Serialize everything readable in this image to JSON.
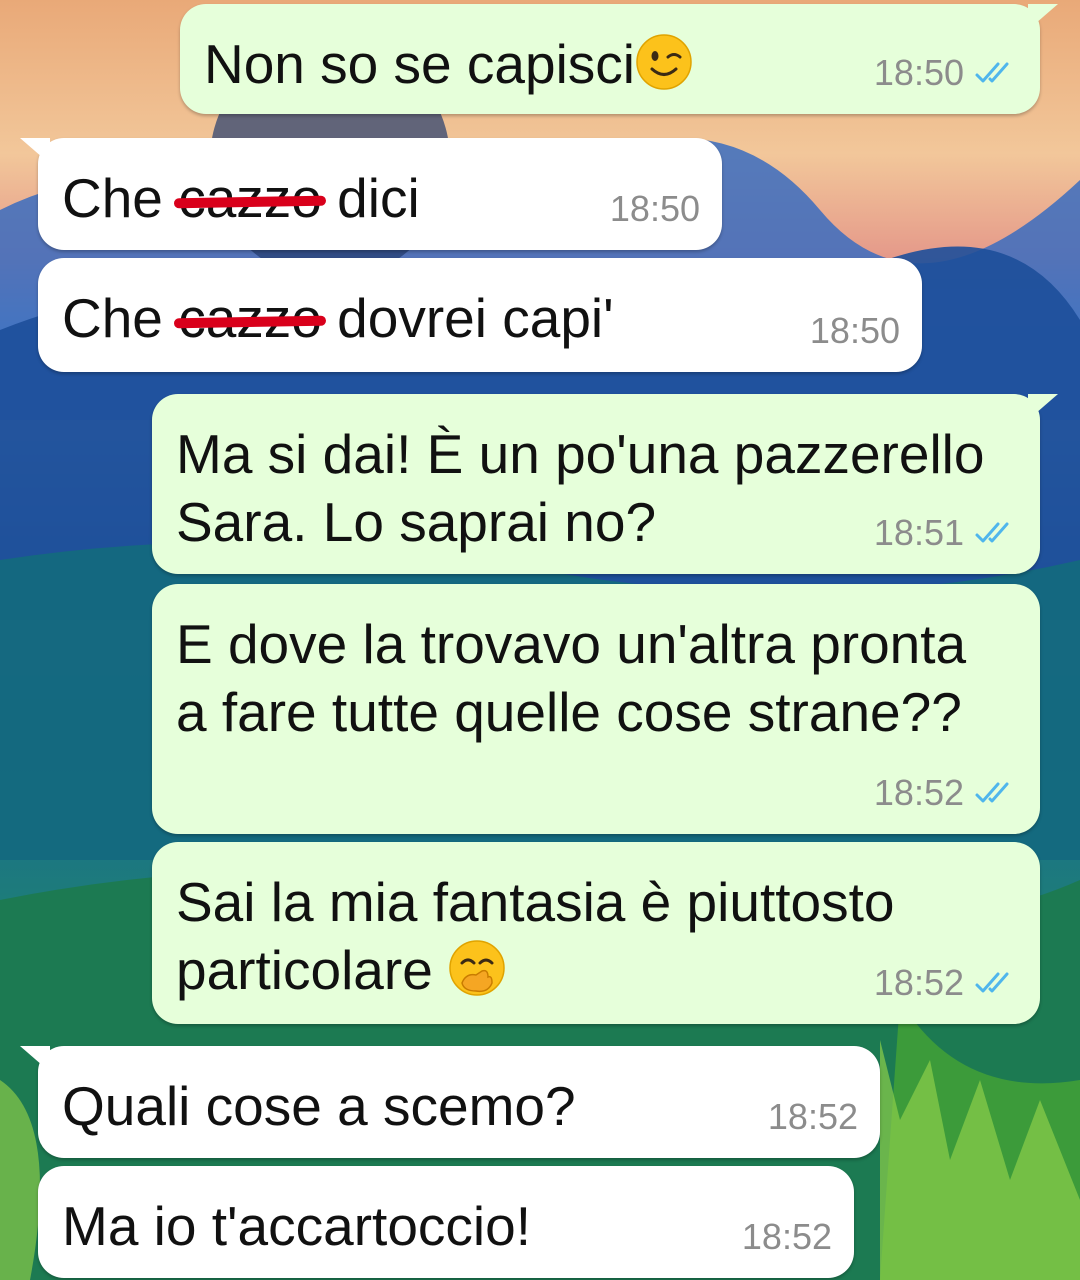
{
  "messages": [
    {
      "dir": "out",
      "parts": [
        {
          "t": "Non so se capisci"
        },
        {
          "emoji": "wink-emoji"
        }
      ],
      "time": "18:50",
      "read": true
    },
    {
      "dir": "in",
      "parts": [
        {
          "t": "Che "
        },
        {
          "r": "cazzo"
        },
        {
          "t": " dici"
        }
      ],
      "time": "18:50"
    },
    {
      "dir": "in",
      "parts": [
        {
          "t": "Che "
        },
        {
          "r": "cazzo"
        },
        {
          "t": " dovrei capi'"
        }
      ],
      "time": "18:50"
    },
    {
      "dir": "out",
      "parts": [
        {
          "t": "Ma si dai! È un po'una pazzerello\nSara. Lo saprai no?"
        }
      ],
      "time": "18:51",
      "read": true
    },
    {
      "dir": "out",
      "parts": [
        {
          "t": "E dove la trovavo un'altra pronta\na fare tutte quelle cose strane??"
        }
      ],
      "time": "18:52",
      "read": true
    },
    {
      "dir": "out",
      "parts": [
        {
          "t": "Sai la mia fantasia è piuttosto\nparticolare "
        },
        {
          "emoji": "hand-over-mouth-emoji"
        }
      ],
      "time": "18:52",
      "read": true
    },
    {
      "dir": "in",
      "parts": [
        {
          "t": "Quali cose a scemo?"
        }
      ],
      "time": "18:52"
    },
    {
      "dir": "in",
      "parts": [
        {
          "t": "Ma io t'accartoccio!"
        }
      ],
      "time": "18:52"
    }
  ],
  "colors": {
    "outgoing_bubble": "#e6ffda",
    "incoming_bubble": "#ffffff",
    "read_ticks": "#4fb6ec",
    "redaction": "#d9001b"
  }
}
